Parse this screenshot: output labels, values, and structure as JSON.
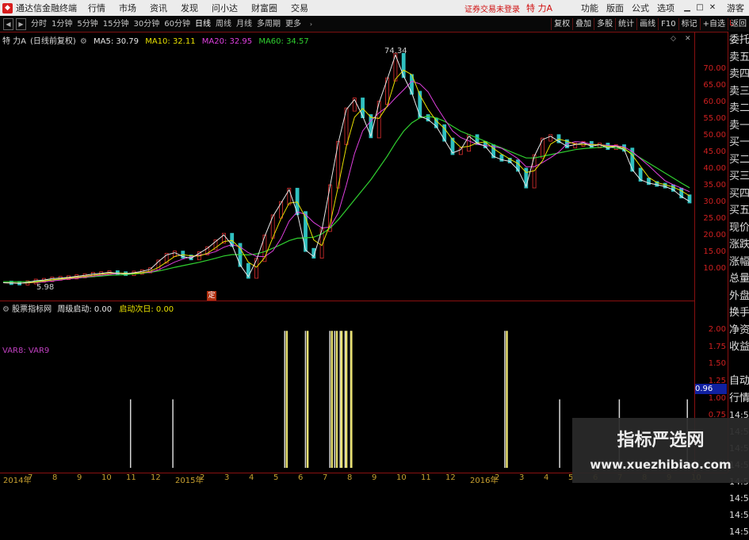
{
  "menubar": {
    "app_title": "通达信金融终端",
    "items": [
      "行情",
      "市场",
      "资讯",
      "发现",
      "问小达",
      "财富圈",
      "交易"
    ],
    "login_status": "证券交易未登录",
    "stock_title": "特 力A",
    "right_items": [
      "功能",
      "版面",
      "公式",
      "选项"
    ],
    "guest": "游客"
  },
  "toolbar": {
    "periods": [
      "分时",
      "1分钟",
      "5分钟",
      "15分钟",
      "30分钟",
      "60分钟",
      "日线",
      "周线",
      "月线",
      "多周期",
      "更多"
    ],
    "active_period": "日线",
    "right_buttons": [
      "复权",
      "叠加",
      "多股",
      "统计",
      "画线",
      "F10",
      "标记",
      "+自选",
      "返回"
    ]
  },
  "legend": {
    "stock": "特 力A",
    "mode": "(日线前复权)",
    "ma5": "MA5: 30.79",
    "ma10": "MA10: 32.11",
    "ma20": "MA20: 32.95",
    "ma60": "MA60: 34.57",
    "colors": {
      "ma5": "#e8e8e8",
      "ma10": "#e8e000",
      "ma20": "#e040e0",
      "ma60": "#30d030"
    }
  },
  "price_chart": {
    "high_label": "74.34",
    "low_label": "5.98",
    "badge": "定",
    "y_ticks": [
      "70.00",
      "65.00",
      "60.00",
      "55.00",
      "50.00",
      "45.00",
      "40.00",
      "35.00",
      "30.00",
      "25.00",
      "20.00",
      "15.00",
      "10.00"
    ],
    "y_range": [
      3,
      77
    ]
  },
  "indicator": {
    "name": "股票指标网",
    "s1": "周级启动: 0.00",
    "s2": "启动次日: 0.00",
    "var_label": "VAR8: VAR9",
    "y_ticks": [
      "2.00",
      "1.75",
      "1.50",
      "1.25",
      "1.00",
      "0.75"
    ],
    "current_value": "0.96",
    "colors": {
      "s1": "#e8e8e8",
      "s2": "#e8e000"
    }
  },
  "right_panel": {
    "items": [
      "委托",
      "卖五",
      "卖四",
      "卖三",
      "卖二",
      "卖一",
      "买一",
      "买二",
      "买三",
      "买四",
      "买五",
      "现价",
      "涨跌",
      "涨幅",
      "总量",
      "外盘",
      "换手",
      "净资",
      "收益",
      "",
      "自动",
      "行情"
    ],
    "times": [
      "14:55",
      "14:55",
      "14:56",
      "14:56",
      "14:56",
      "14:56",
      "14:56",
      "14:56"
    ],
    "corner": "L"
  },
  "x_axis": {
    "labels": [
      "2014年",
      "7",
      "8",
      "9",
      "10",
      "11",
      "12",
      "2015年",
      "2",
      "3",
      "4",
      "5",
      "6",
      "7",
      "8",
      "9",
      "10",
      "11",
      "12",
      "2016年",
      "2",
      "3",
      "4",
      "5",
      "6",
      "7",
      "8",
      "9",
      "10"
    ]
  },
  "watermark": {
    "line1": "指标严选网",
    "line2": "www.xuezhibiao.com"
  },
  "chart_data": {
    "type": "line",
    "title": "",
    "price_series": [
      6.2,
      6.1,
      5.98,
      6.3,
      6.8,
      7.0,
      7.4,
      7.6,
      7.8,
      8.1,
      8.4,
      8.8,
      9.0,
      9.3,
      9.0,
      8.8,
      9.2,
      9.6,
      10.2,
      12.5,
      14.5,
      15.2,
      14.0,
      13.5,
      15.0,
      16.5,
      18.5,
      20.5,
      17.5,
      11.5,
      8.0,
      13.0,
      20.0,
      26.0,
      30.0,
      34.0,
      27.0,
      16.0,
      14.0,
      22.0,
      35.0,
      48.0,
      58.0,
      61.0,
      56.0,
      50.0,
      60.0,
      67.0,
      74.34,
      68.0,
      63.0,
      56.0,
      55.0,
      53.0,
      49.0,
      45.0,
      46.0,
      50.0,
      48.0,
      47.0,
      44.0,
      43.0,
      42.5,
      40.0,
      35.0,
      44.0,
      49.0,
      50.0,
      48.5,
      47.0,
      47.5,
      48.0,
      47.0,
      47.5,
      46.5,
      47.0,
      46.0,
      40.0,
      37.0,
      36.0,
      35.5,
      35.0,
      34.0,
      32.0,
      30.5
    ],
    "ma60_series": [
      6.5,
      6.5,
      6.5,
      6.5,
      6.6,
      6.8,
      7.0,
      7.2,
      7.4,
      7.6,
      7.8,
      8.0,
      8.2,
      8.4,
      8.5,
      8.6,
      8.8,
      9.0,
      9.3,
      9.7,
      10.2,
      10.8,
      11.3,
      11.8,
      12.3,
      12.9,
      13.5,
      14.2,
      14.6,
      14.6,
      14.5,
      14.8,
      15.5,
      16.5,
      17.6,
      18.8,
      19.5,
      19.6,
      19.8,
      20.8,
      22.5,
      25.0,
      28.0,
      31.0,
      34.0,
      37.0,
      40.5,
      44.0,
      48.0,
      51.5,
      54.0,
      55.5,
      56.0,
      55.5,
      54.5,
      53.0,
      51.5,
      50.5,
      49.5,
      48.5,
      47.5,
      46.5,
      45.5,
      44.5,
      43.5,
      43.5,
      44.0,
      44.5,
      45.0,
      45.5,
      46.0,
      46.3,
      46.5,
      46.7,
      46.8,
      46.5,
      46.0,
      45.0,
      43.5,
      42.0,
      40.5,
      39.0,
      37.5,
      36.0,
      34.6
    ],
    "ylim": [
      3,
      77
    ],
    "indicator_spikes_white": [
      0.188,
      0.249,
      0.41,
      0.44,
      0.475,
      0.482,
      0.49,
      0.497,
      0.505,
      0.727,
      0.806,
      0.892,
      0.99
    ],
    "indicator_spikes_yellow": [
      0.41,
      0.44,
      0.475,
      0.482,
      0.489,
      0.496,
      0.503,
      0.727
    ],
    "indicator_ylim": [
      0,
      2.2
    ]
  }
}
